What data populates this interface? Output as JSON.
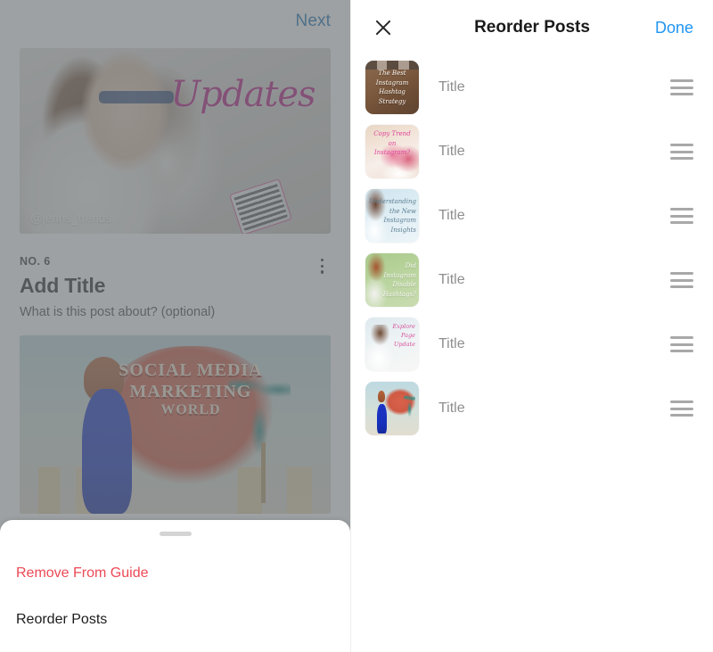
{
  "left": {
    "next_label": "Next",
    "hero": {
      "script_text": "Updates",
      "handle": "@jenns_trends"
    },
    "post": {
      "number_label": "NO. 6",
      "title": "Add Title",
      "subtitle": "What is this post about? (optional)"
    },
    "second_image": {
      "line1": "SOCIAL MEDIA",
      "line2": "MARKETING",
      "line3": "WORLD"
    }
  },
  "sheet": {
    "actions": [
      {
        "label": "Remove From Guide",
        "style": "destructive"
      },
      {
        "label": "Reorder Posts",
        "style": "normal"
      }
    ]
  },
  "right": {
    "close_icon": "close-icon",
    "title": "Reorder Posts",
    "done_label": "Done",
    "rows": [
      {
        "title_placeholder": "Title",
        "thumb_class": "t1",
        "thumb_lines": [
          "The Best",
          "Instagram",
          "Hashtag",
          "Strategy"
        ],
        "handle_icon": "drag-handle-icon"
      },
      {
        "title_placeholder": "Title",
        "thumb_class": "t2",
        "thumb_lines": [
          "Copy Trend",
          "on",
          "Instagram?"
        ],
        "handle_icon": "drag-handle-icon"
      },
      {
        "title_placeholder": "Title",
        "thumb_class": "t3",
        "thumb_lines": [
          "Understanding",
          "the New",
          "Instagram",
          "Insights"
        ],
        "handle_icon": "drag-handle-icon"
      },
      {
        "title_placeholder": "Title",
        "thumb_class": "t4",
        "thumb_lines": [
          "Did",
          "Instagram",
          "Disable",
          "Hashtags?"
        ],
        "handle_icon": "drag-handle-icon"
      },
      {
        "title_placeholder": "Title",
        "thumb_class": "t5",
        "thumb_lines": [
          "Explore",
          "Page",
          "Update"
        ],
        "handle_icon": "drag-handle-icon"
      },
      {
        "title_placeholder": "Title",
        "thumb_class": "t6",
        "thumb_lines": [],
        "handle_icon": "drag-handle-icon"
      }
    ]
  },
  "colors": {
    "accent_blue": "#2095f3",
    "dimmed_blue": "#1c6fb0",
    "destructive_red": "#ed4956",
    "placeholder_gray": "#8e8e8e",
    "magenta_script": "#b3157f"
  }
}
